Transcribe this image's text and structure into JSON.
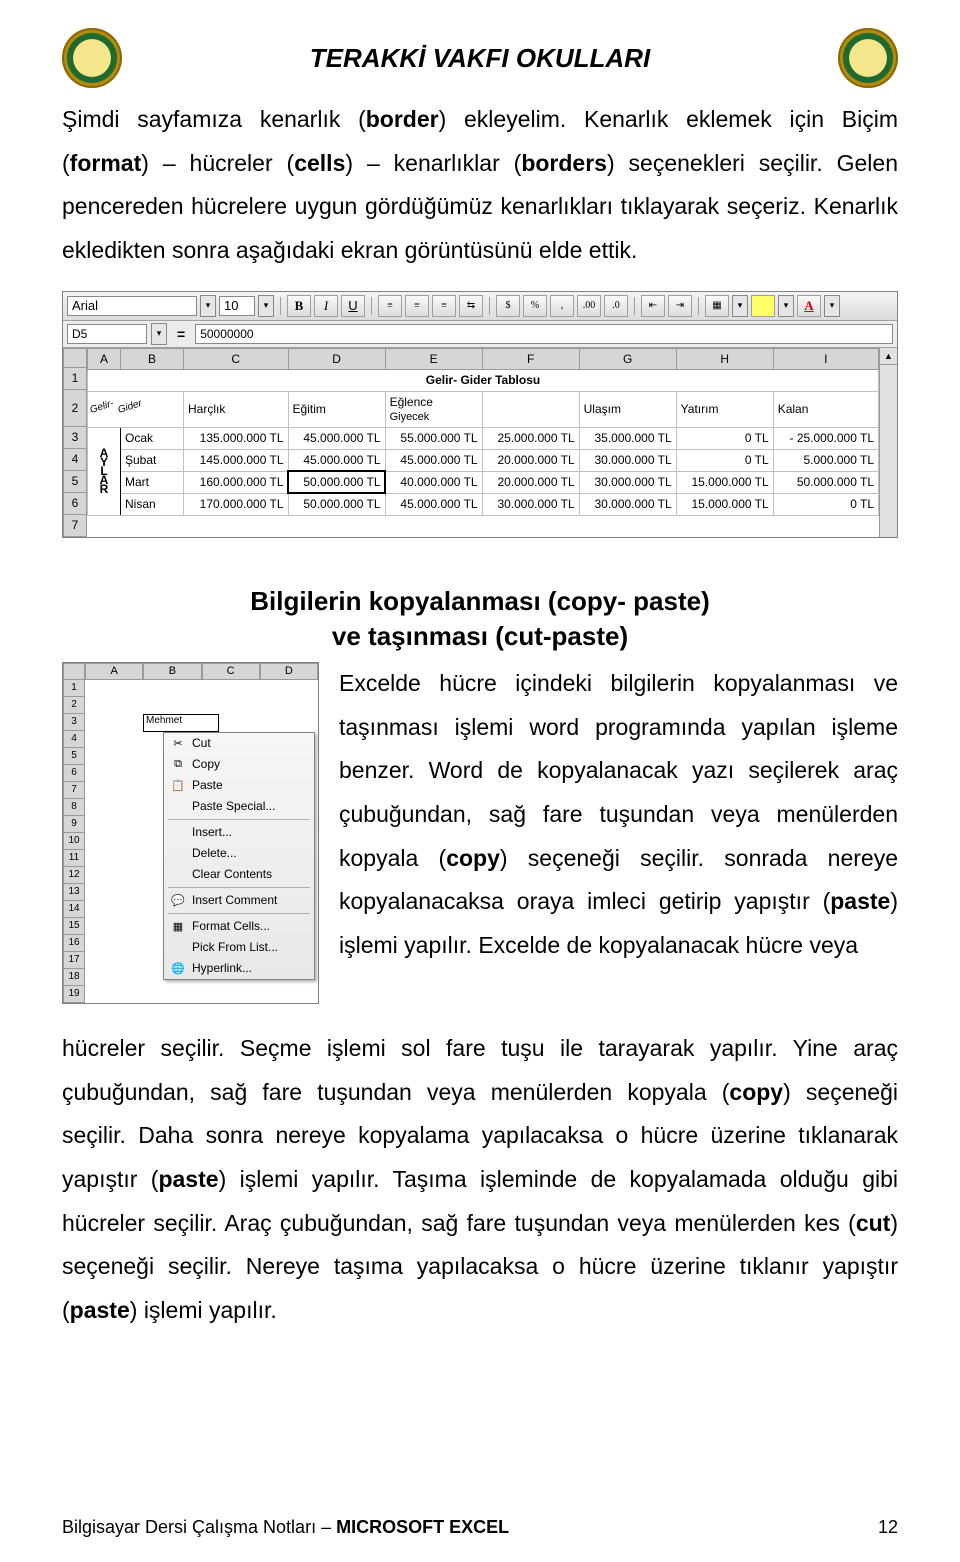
{
  "header": {
    "title": "TERAKKİ VAKFI OKULLARI"
  },
  "intro": {
    "p1a": "Şimdi sayfamıza kenarlık (",
    "p1b_bold": "border",
    "p1c": ") ekleyelim. Kenarlık eklemek için Biçim (",
    "p1d_bold": "format",
    "p1e": ") – hücreler (",
    "p1f_bold": "cells",
    "p1g": ") – kenarlıklar (",
    "p1h_bold": "borders",
    "p1i": ") seçenekleri seçilir. Gelen pencereden hücrelere uygun gördüğümüz kenarlıkları tıklayarak seçeriz. Kenarlık ekledikten sonra aşağıdaki ekran görüntüsünü elde ettik."
  },
  "toolbar": {
    "font": "Arial",
    "size": "10",
    "B": "B",
    "I": "I",
    "U": "U",
    "pct": "%",
    "comma": ",",
    "dec1": ".00",
    "dec2": ".0",
    "currency": "$",
    "namebox": "D5",
    "formula": "50000000",
    "eq": "="
  },
  "sheet1": {
    "cols": [
      "A",
      "B",
      "C",
      "D",
      "E",
      "F",
      "G",
      "H",
      "I"
    ],
    "row_nums": [
      "1",
      "2",
      "3",
      "4",
      "5",
      "6",
      "7"
    ],
    "title": "Gelir- Gider Tablosu",
    "h2": {
      "a_rot1": "Gelir-",
      "a_rot2": "Gider",
      "c": "Harçlık",
      "d": "Eğitim",
      "e": "Eğlence",
      "f": "Giyecek",
      "g": "Ulaşım",
      "h": "Yatırım",
      "i": "Kalan"
    },
    "aylar": [
      "A",
      "Y",
      "L",
      "A",
      "R"
    ],
    "rows": [
      {
        "b": "Ocak",
        "c": "135.000.000 TL",
        "d": "45.000.000 TL",
        "e": "55.000.000 TL",
        "f": "25.000.000 TL",
        "g": "35.000.000 TL",
        "h": "0 TL",
        "i": "- 25.000.000 TL"
      },
      {
        "b": "Şubat",
        "c": "145.000.000 TL",
        "d": "45.000.000 TL",
        "e": "45.000.000 TL",
        "f": "20.000.000 TL",
        "g": "30.000.000 TL",
        "h": "0 TL",
        "i": "5.000.000 TL"
      },
      {
        "b": "Mart",
        "c": "160.000.000 TL",
        "d": "50.000.000 TL",
        "e": "40.000.000 TL",
        "f": "20.000.000 TL",
        "g": "30.000.000 TL",
        "h": "15.000.000 TL",
        "i": "50.000.000 TL"
      },
      {
        "b": "Nisan",
        "c": "170.000.000 TL",
        "d": "50.000.000 TL",
        "e": "45.000.000 TL",
        "f": "30.000.000 TL",
        "g": "30.000.000 TL",
        "h": "15.000.000 TL",
        "i": "0 TL"
      }
    ]
  },
  "section": {
    "h_line1": "Bilgilerin kopyalanması (copy- paste)",
    "h_line2": "ve taşınması (cut-paste)"
  },
  "ctx": {
    "cols": [
      "A",
      "B",
      "C",
      "D"
    ],
    "rows": [
      "1",
      "2",
      "3",
      "4",
      "5",
      "6",
      "7",
      "8",
      "9",
      "10",
      "11",
      "12",
      "13",
      "14",
      "15",
      "16",
      "17",
      "18",
      "19"
    ],
    "sel_cell": "Mehmet",
    "menu": {
      "cut": "Cut",
      "copy": "Copy",
      "paste": "Paste",
      "paste_special": "Paste Special...",
      "insert": "Insert...",
      "delete": "Delete...",
      "clear": "Clear Contents",
      "insert_comment": "Insert Comment",
      "format_cells": "Format Cells...",
      "pick_list": "Pick From List...",
      "hyperlink": "Hyperlink..."
    }
  },
  "copy_text": {
    "t1": "Excelde hücre içindeki bilgilerin kopyalanması ve taşınması işlemi word programında yapılan işleme benzer. Word de kopyalanacak yazı seçilerek araç çubuğundan, sağ fare tuşundan  veya menülerden kopyala (",
    "t1b": "copy",
    "t1c": ") seçeneği seçilir. sonrada nereye kopyalanacaksa oraya imleci getirip yapıştır  (",
    "t1d": "paste",
    "t1e": ") işlemi yapılır. Excelde de  kopyalanacak hücre veya",
    "t2a": "hücreler seçilir. Seçme işlemi sol fare tuşu ile tarayarak yapılır.  Yine araç çubuğundan, sağ fare tuşundan  veya menülerden kopyala (",
    "t2b": "copy",
    "t2c": ") seçeneği seçilir. Daha sonra nereye kopyalama yapılacaksa o hücre üzerine tıklanarak yapıştır (",
    "t2d": "paste",
    "t2e": ")  işlemi yapılır. Taşıma işleminde de kopyalamada olduğu gibi hücreler seçilir. Araç çubuğundan, sağ fare tuşundan  veya menülerden kes (",
    "t2f": "cut",
    "t2g": ") seçeneği seçilir. Nereye taşıma yapılacaksa o hücre üzerine tıklanır yapıştır (",
    "t2h": "paste",
    "t2i": ") işlemi yapılır."
  },
  "footer": {
    "left_a": "Bilgisayar Dersi Çalışma Notları – ",
    "left_b": "MICROSOFT EXCEL",
    "page": "12"
  }
}
